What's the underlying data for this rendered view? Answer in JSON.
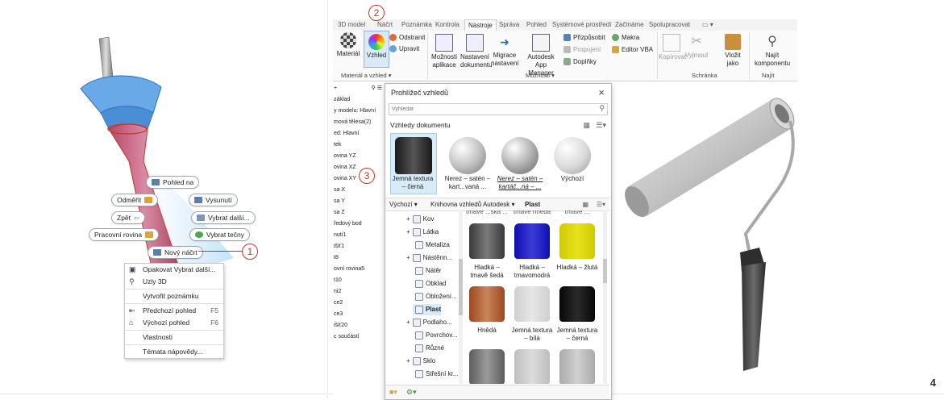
{
  "page_number": "4",
  "left_scene": {
    "marking_menu": {
      "view_face": "Pohled na",
      "measure": "Odměřit",
      "extrude": "Vysunutí",
      "back": "Zpět",
      "select_other": "Vybrat další...",
      "work_plane": "Pracovní rovina",
      "select_tangent": "Vybrat tečny",
      "new_sketch": "Nový náčrt"
    },
    "context_menu": [
      {
        "label": "Opakovat Vybrat další...",
        "shortcut": "",
        "icon": "repeat-icon"
      },
      {
        "label": "Uzly 3D",
        "shortcut": "",
        "icon": "grips-3d-icon"
      },
      {
        "label": "Vytvořit poznámku",
        "shortcut": "",
        "icon": ""
      },
      {
        "label": "Předchozí pohled",
        "shortcut": "F5",
        "icon": "previous-view-icon"
      },
      {
        "label": "Výchozí pohled",
        "shortcut": "F6",
        "icon": "home-view-icon"
      },
      {
        "label": "Vlastnosti",
        "shortcut": "",
        "icon": ""
      },
      {
        "label": "Témata nápovědy...",
        "shortcut": "",
        "icon": ""
      }
    ],
    "callout": "1"
  },
  "ribbon": {
    "tabs": [
      "3D model",
      "Náčrt",
      "Poznámka",
      "Kontrola",
      "Nástroje",
      "Správa",
      "Pohled",
      "Systémové prostředí",
      "Začínáme",
      "Spolupracovat"
    ],
    "active_tab": "Nástroje",
    "callout": "2",
    "buttons": {
      "material": "Materiál",
      "appearance": "Vzhled",
      "clear": "Odstranit",
      "adjust": "Upravit",
      "app_options": "Možnosti aplikace",
      "doc_settings": "Nastavení dokumentu",
      "migrate": "Migrace nastavení",
      "app_manager": "Autodesk App Manager",
      "customize": "Přizpůsobit",
      "link": "Propojení",
      "addins": "Doplňky",
      "macros": "Makra",
      "vba_editor": "Editor VBA",
      "copy_as": "Kopírovat",
      "cut": "Vyjmout",
      "paste_as": "Vložit jako",
      "find_component": "Najít komponentu"
    },
    "groups": {
      "material_appearance": "Materiál a vzhled",
      "options": "Možnosti",
      "clipboard": "Schránka",
      "find": "Najít"
    }
  },
  "model_browser": {
    "plus": "+",
    "rows": [
      "základ",
      "y modelu: Hlavní",
      "mová tělesa(2)",
      "ed: Hlavní",
      "tek",
      "ovina YZ",
      "ovina XZ",
      "ovina XY",
      "sa X",
      "sa Y",
      "sa Z",
      "ředový bod",
      "nutí1",
      "išiť1",
      "t8",
      "ovní rovina5",
      "t10",
      "ni2",
      "ce2",
      "ce3",
      "išiť20",
      "c součástí"
    ]
  },
  "appearance_browser": {
    "title": "Prohlížeč vzhledů",
    "search_placeholder": "Vyhledat",
    "doc_section": "Vzhledy dokumentu",
    "callout": "3",
    "doc_items": [
      {
        "label": "Jemná textura – černá",
        "color": "#2e2e2e",
        "shape": "cylinder",
        "selected": true
      },
      {
        "label": "Nerez – satén – kart...vaná ...",
        "color": "#bdbdbd",
        "shape": "sphere",
        "selected": false
      },
      {
        "label": "Nerez – satén – kartáč...ná – ...",
        "color": "#a9a9a9",
        "shape": "sphere",
        "selected": false
      },
      {
        "label": "Výchozí",
        "color": "#d9d9d9",
        "shape": "sphere",
        "selected": false
      }
    ],
    "filter_default": "Výchozí",
    "library": "Knihovna vzhledů Autodesk",
    "category": "Plast",
    "tree": [
      {
        "label": "Kov",
        "expand": "+"
      },
      {
        "label": "Látka",
        "expand": "+"
      },
      {
        "label": "Metaliza",
        "expand": ""
      },
      {
        "label": "Nástěnn...",
        "expand": "+"
      },
      {
        "label": "Nátěr",
        "expand": ""
      },
      {
        "label": "Obklad",
        "expand": ""
      },
      {
        "label": "Obložení...",
        "expand": ""
      },
      {
        "label": "Plast",
        "expand": ""
      },
      {
        "label": "Podlaho...",
        "expand": "+"
      },
      {
        "label": "Povrchov...",
        "expand": ""
      },
      {
        "label": "Různé",
        "expand": ""
      },
      {
        "label": "Sklo",
        "expand": "+"
      },
      {
        "label": "Střešní kr...",
        "expand": ""
      }
    ],
    "top_partial_labels": [
      "tmavé ...ská ...",
      "tmavě hnědá",
      "tmavé ..."
    ],
    "items": [
      {
        "label": "Hladká – tmavě šedá",
        "color": "#7a7a7a"
      },
      {
        "label": "Hladká – tmavomodrá",
        "color": "#3b3bd6"
      },
      {
        "label": "Hladká – žlutá",
        "color": "#e6e21a"
      },
      {
        "label": "Hnědá",
        "color": "#c9865a"
      },
      {
        "label": "Jemná textura – bílá",
        "color": "#e6e6e6"
      },
      {
        "label": "Jemná textura – černá",
        "color": "#2b2b2b"
      },
      {
        "label": "",
        "color": "#9a9a9a"
      },
      {
        "label": "",
        "color": "#dcdcdc"
      },
      {
        "label": "",
        "color": "#d0d0d0"
      }
    ],
    "close": "×"
  },
  "colors": {
    "accent_red": "#c0392b",
    "selection_blue": "#4a90d9",
    "handle_red": "#c0506a"
  }
}
